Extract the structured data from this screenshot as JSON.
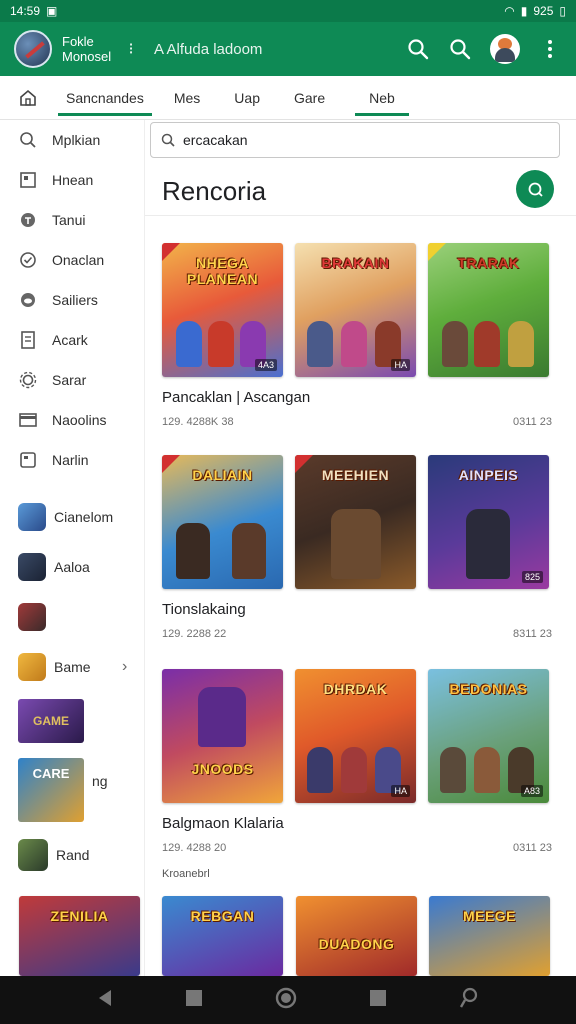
{
  "status": {
    "time": "14:59",
    "battery": "925"
  },
  "appbar": {
    "name_line1": "Fokle",
    "name_line2": "Monosel",
    "title": "A Alfuda ladoom",
    "menu_glyph": "⁝"
  },
  "tabs": [
    {
      "label": "Sancnandes",
      "active": true
    },
    {
      "label": "Mes",
      "active": false
    },
    {
      "label": "Uap",
      "active": false
    },
    {
      "label": "Gare",
      "active": false
    },
    {
      "label": "Neb",
      "active": true
    }
  ],
  "sidebar": {
    "items": [
      {
        "label": "Mplkian",
        "icon": "search-icon"
      },
      {
        "label": "Hnean",
        "icon": "square-icon"
      },
      {
        "label": "Tanui",
        "icon": "dot-icon"
      },
      {
        "label": "Onaclan",
        "icon": "check-circle-icon"
      },
      {
        "label": "Sailiers",
        "icon": "cloud-icon"
      },
      {
        "label": "Acark",
        "icon": "doc-icon"
      },
      {
        "label": "Sarar",
        "icon": "gear-icon"
      },
      {
        "label": "Naoolins",
        "icon": "card-icon"
      },
      {
        "label": "Narlin",
        "icon": "frame-icon"
      }
    ],
    "apps": [
      {
        "label": "Cianelom",
        "color": "#3b6fb5"
      },
      {
        "label": "Aaloa",
        "color": "#2c3e55"
      },
      {
        "label": "",
        "color": "#7a2d2d"
      },
      {
        "label": "Bame",
        "color": "#e3a52b"
      },
      {
        "label": "",
        "color": "#5b3b8f"
      },
      {
        "label": "ng",
        "color": "#2f82c9"
      },
      {
        "label": "Rand",
        "color": "#3a5b3a"
      }
    ],
    "app_badge": "GAME",
    "app_label_2": "CARE"
  },
  "search": {
    "value": "ercacakan"
  },
  "section_title": "Rencoria",
  "games": [
    {
      "title": "Pancaklan | Ascangan",
      "meta_left": "129. 4288K 38",
      "meta_right": "0311 23",
      "tiles": [
        {
          "name": "NHEGA PLANEAN",
          "bg1": "#f2b34a",
          "bg2": "#4a6fd0",
          "tag": "4A3"
        },
        {
          "name": "BRAKAIN",
          "bg1": "#f5e0b0",
          "bg2": "#7a4ab0",
          "tag": "HA"
        },
        {
          "name": "TRARAK",
          "bg1": "#5fae3c",
          "bg2": "#3a7a30",
          "tag": ""
        }
      ]
    },
    {
      "title": "Tionslakaing",
      "meta_left": "129. 2288 22",
      "meta_right": "8311 23",
      "tiles": [
        {
          "name": "DALIAIN",
          "bg1": "#e6b95a",
          "bg2": "#2a68b0",
          "tag": ""
        },
        {
          "name": "MEEHIEN",
          "bg1": "#3a2a22",
          "bg2": "#8a5a2a",
          "tag": ""
        },
        {
          "name": "AINPEIS",
          "bg1": "#2a3a7a",
          "bg2": "#9a3aa0",
          "tag": "825"
        }
      ]
    },
    {
      "title": "Balgmaon Klalaria",
      "meta_left": "129. 4288 20",
      "meta_right": "0311 23",
      "tiles": [
        {
          "name": "JNOODS",
          "bg1": "#7a2ea8",
          "bg2": "#f0a53a",
          "tag": ""
        },
        {
          "name": "DHRDAK",
          "bg1": "#e05a2a",
          "bg2": "#7a2a2a",
          "tag": "HA"
        },
        {
          "name": "BEDONIAS",
          "bg1": "#7ac0e0",
          "bg2": "#4a8a3a",
          "tag": "A83"
        }
      ]
    }
  ],
  "extra_label": "Kroanebrl",
  "bottom_tiles": [
    {
      "name": "ZENILIA",
      "bg1": "#c03a3a",
      "bg2": "#3a3a8a"
    },
    {
      "name": "REBGAN",
      "bg1": "#3a8ad0",
      "bg2": "#6a2aa0"
    },
    {
      "name": "DUADONG",
      "bg1": "#f09030",
      "bg2": "#a02a2a"
    },
    {
      "name": "MEEGE",
      "bg1": "#3a7ad0",
      "bg2": "#e0a030"
    }
  ]
}
